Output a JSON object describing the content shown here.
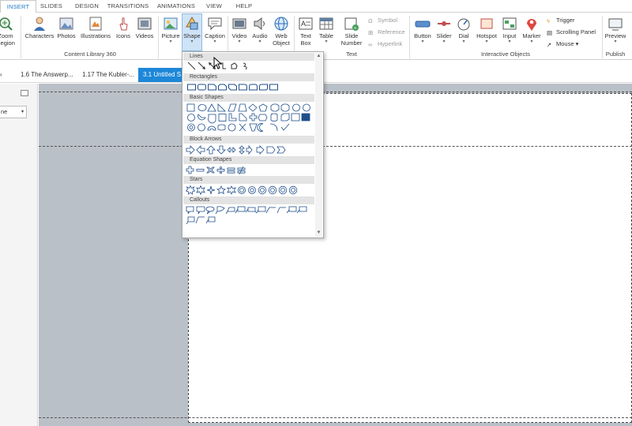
{
  "ribbon_tabs": [
    {
      "label": "INSERT",
      "active": true
    },
    {
      "label": "SLIDES"
    },
    {
      "label": "DESIGN"
    },
    {
      "label": "TRANSITIONS"
    },
    {
      "label": "ANIMATIONS"
    },
    {
      "label": "VIEW"
    },
    {
      "label": "HELP"
    }
  ],
  "ribbon": {
    "zoom_region": {
      "line1": "Zoom",
      "line2": "Region"
    },
    "characters": "Characters",
    "photos": "Photos",
    "illustrations": "Illustrations",
    "icons": "Icons",
    "videos": "Videos",
    "content_library_group": "Content Library 360",
    "picture": "Picture",
    "shape": "Shape",
    "caption": "Caption",
    "video": "Video",
    "audio": "Audio",
    "web_object": {
      "line1": "Web",
      "line2": "Object"
    },
    "text_box": {
      "line1": "Text",
      "line2": "Box"
    },
    "table": "Table",
    "slide_number": {
      "line1": "Slide",
      "line2": "Number"
    },
    "symbol": "Symbol",
    "reference": "Reference",
    "hyperlink": "Hyperlink",
    "text_group": "Text",
    "button": "Button",
    "slider": "Slider",
    "dial": "Dial",
    "hotspot": "Hotspot",
    "input": "Input",
    "marker": "Marker",
    "trigger": "Trigger",
    "scrolling_panel": "Scrolling Panel",
    "mouse": "Mouse",
    "interactive_group": "Interactive Objects",
    "preview": "Preview",
    "publish_group": "Publish"
  },
  "slide_tabs": [
    {
      "label": "1.6 The Answerp..."
    },
    {
      "label": "1.17 The Kubler-..."
    },
    {
      "label": "3.1 Untitled S",
      "active": true
    }
  ],
  "left_panel": {
    "select_value": "ne"
  },
  "shape_menu": {
    "sections": [
      "Lines",
      "Rectangles",
      "Basic Shapes",
      "Block Arrows",
      "Equation Shapes",
      "Stars",
      "Callouts"
    ]
  },
  "colors": {
    "accent": "#1e78c8",
    "active_slide_tab": "#1d87d8",
    "canvas_bg": "#b9c0c8"
  }
}
